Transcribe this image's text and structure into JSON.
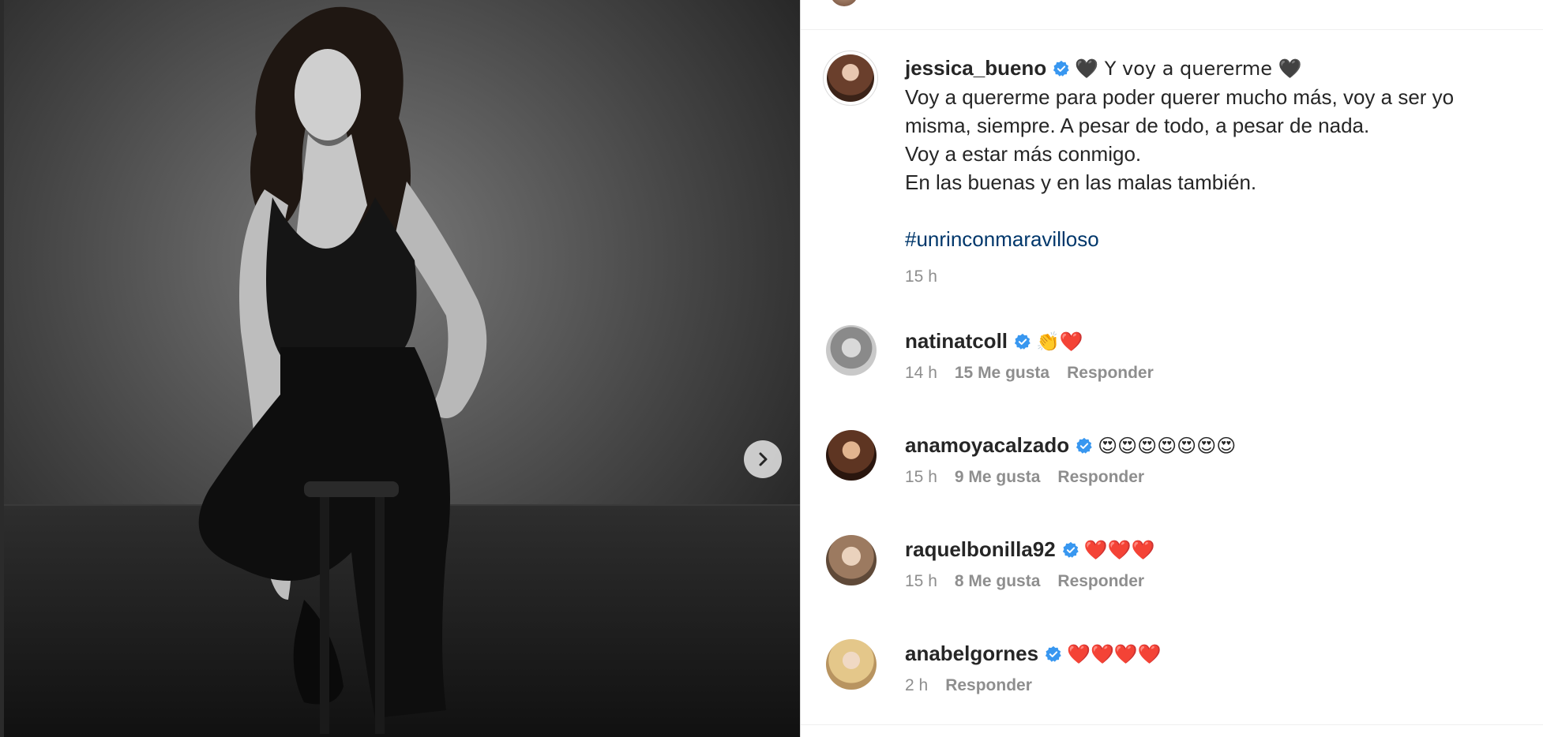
{
  "post": {
    "next_button_icon": "chevron-right-icon",
    "caption": {
      "username": "jessica_bueno",
      "heading": "🖤 Y voy a quererme 🖤",
      "lines": [
        "Voy a quererme para poder querer mucho más, voy a ser yo",
        "misma, siempre. A pesar de todo, a pesar de nada.",
        "Voy a estar más conmigo.",
        "En las buenas y en las malas también."
      ],
      "hashtag": "#unrinconmaravilloso",
      "time": "15 h"
    },
    "comments": [
      {
        "username": "natinatcoll",
        "text": "👏❤️",
        "time": "14 h",
        "likes": "15 Me gusta",
        "reply": "Responder"
      },
      {
        "username": "anamoyacalzado",
        "text": "😍😍😍😍😍😍😍",
        "time": "15 h",
        "likes": "9 Me gusta",
        "reply": "Responder"
      },
      {
        "username": "raquelbonilla92",
        "text": "❤️❤️❤️",
        "time": "15 h",
        "likes": "8 Me gusta",
        "reply": "Responder"
      },
      {
        "username": "anabelgornes",
        "text": "❤️❤️❤️❤️",
        "time": "2 h",
        "likes": "",
        "reply": "Responder"
      }
    ]
  },
  "colors": {
    "verified": "#3897f0",
    "hashtag": "#00376b",
    "meta": "#8e8e8e"
  }
}
